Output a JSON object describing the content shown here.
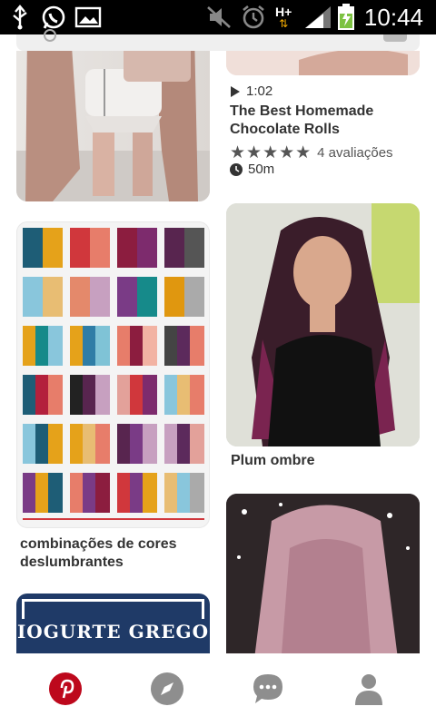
{
  "status_bar": {
    "time": "10:44",
    "network": "H+",
    "icons": [
      "usb-icon",
      "whatsapp-icon",
      "gallery-icon",
      "mute-icon",
      "alarm-icon",
      "network-icon",
      "signal-icon",
      "battery-charging-icon"
    ]
  },
  "feed": {
    "pin_recipe": {
      "duration_video": "1:02",
      "title": "The Best Homemade Chocolate Rolls",
      "rating_text": "4 avaliações",
      "stars": 5,
      "time": "50m"
    },
    "pin_colors": {
      "title": "combinações de cores deslumbrantes"
    },
    "pin_plum": {
      "title": "Plum ombre"
    },
    "pin_yogurt": {
      "label": "IOGURTE GREGO"
    }
  },
  "bottom_nav": {
    "items": [
      "home-pinterest-icon",
      "explore-compass-icon",
      "messages-icon",
      "profile-icon"
    ],
    "brand_color": "#bd081c",
    "inactive_color": "#8e8e8e"
  }
}
